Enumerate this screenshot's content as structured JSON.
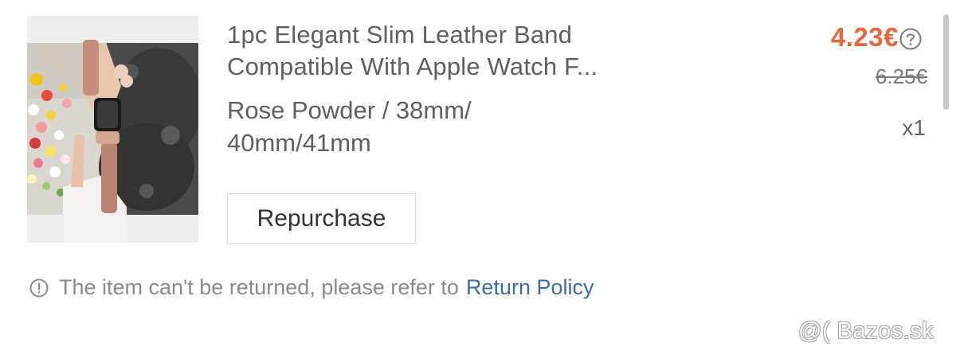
{
  "product": {
    "image_alt": "Rose leather Apple Watch band worn on wrist",
    "title": "1pc Elegant Slim Leather Band Compatible With Apple Watch F...",
    "variant": "Rose Powder / 38mm/ 40mm/41mm",
    "price": "4.23€",
    "original_price": "6.25€",
    "quantity": "x1",
    "price_info_icon": "question-circle-icon"
  },
  "actions": {
    "repurchase_label": "Repurchase"
  },
  "notice": {
    "icon": "exclamation-circle-icon",
    "text": "The item can't be returned, please refer to",
    "link_label": "Return Policy"
  },
  "watermark": {
    "text": "@( Bazos.sk"
  },
  "colors": {
    "price": "#e5673c",
    "link": "#3b6aa0",
    "muted_text": "#8a8a8a"
  }
}
